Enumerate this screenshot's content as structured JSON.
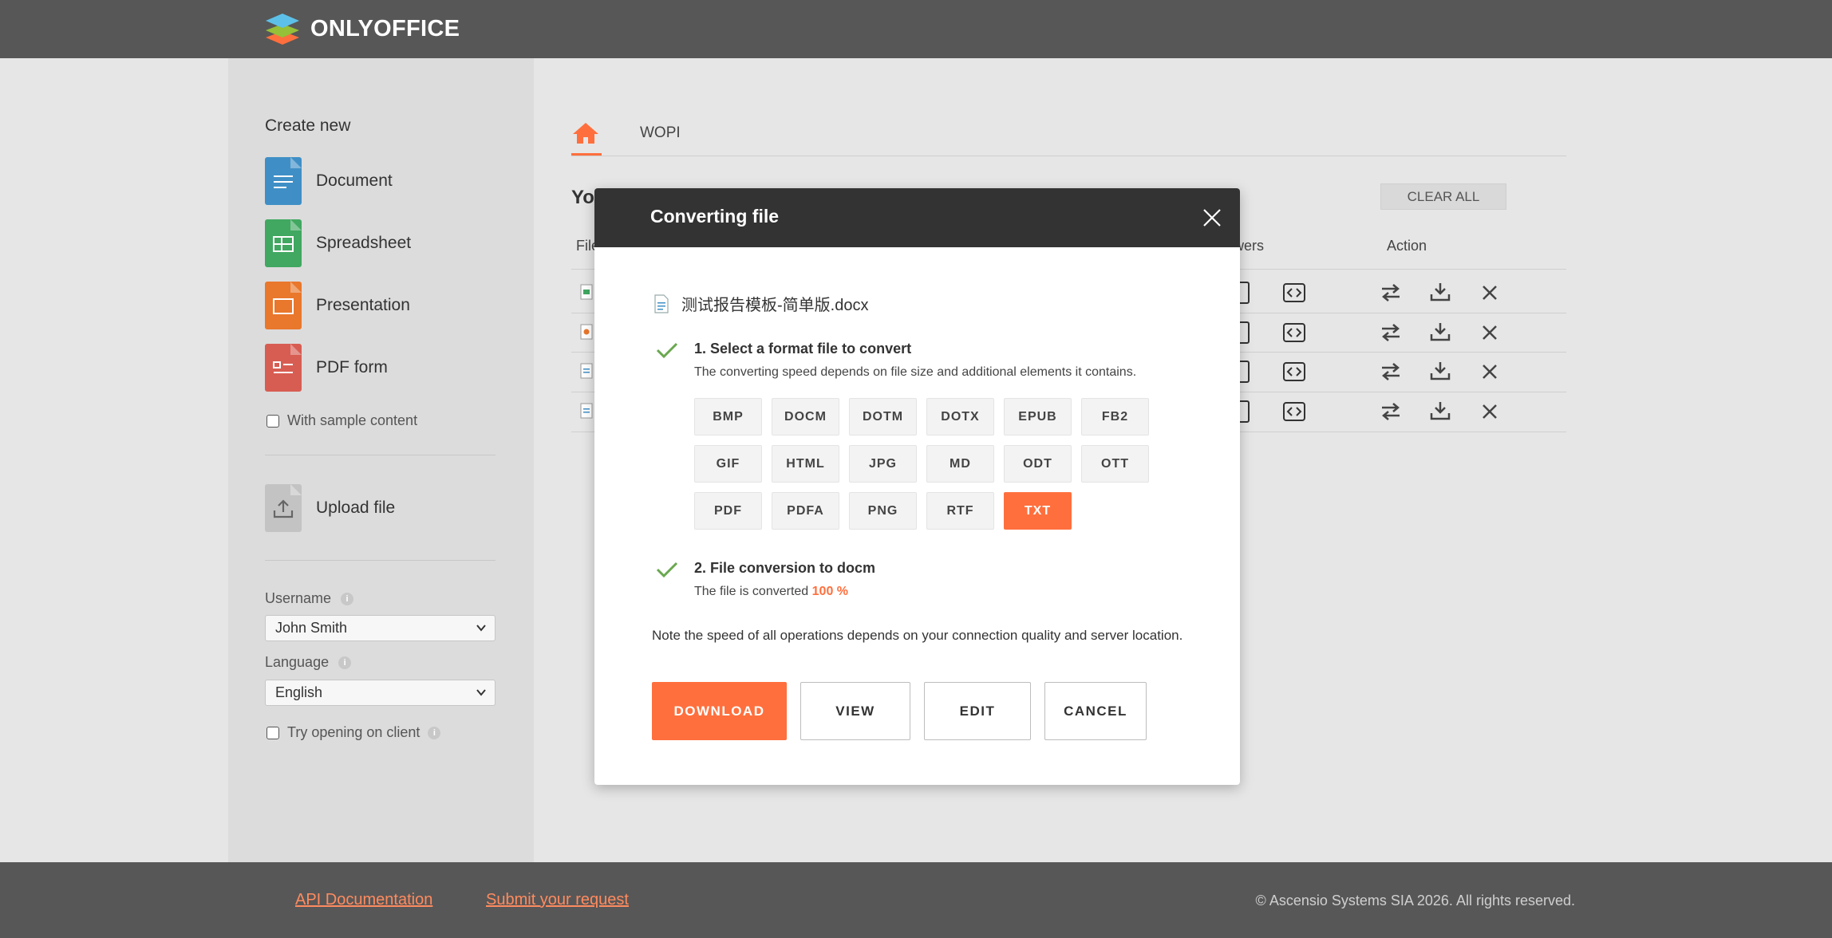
{
  "header": {
    "brand": "ONLYOFFICE"
  },
  "sidebar": {
    "create_title": "Create new",
    "create_items": [
      {
        "label": "Document",
        "color": "#3f8fc6",
        "icon": "document-icon"
      },
      {
        "label": "Spreadsheet",
        "color": "#40a860",
        "icon": "spreadsheet-icon"
      },
      {
        "label": "Presentation",
        "color": "#e9772c",
        "icon": "presentation-icon"
      },
      {
        "label": "PDF form",
        "color": "#d75d52",
        "icon": "pdf-form-icon"
      }
    ],
    "sample_label": "With sample content",
    "upload_label": "Upload file",
    "username_label": "Username",
    "username_value": "John Smith",
    "language_label": "Language",
    "language_value": "English",
    "try_client_label": "Try opening on client"
  },
  "main": {
    "tab_wopi": "WOPI",
    "your_files": "Yo",
    "clear_all": "CLEAR ALL",
    "col_file": "File",
    "col_viewers": "wers",
    "col_action": "Action"
  },
  "modal": {
    "title": "Converting file",
    "file_name": "测试报告模板-简单版.docx",
    "step1_title": "1. Select a format file to convert",
    "step1_sub": "The converting speed depends on file size and additional elements it contains.",
    "formats": [
      "BMP",
      "DOCM",
      "DOTM",
      "DOTX",
      "EPUB",
      "FB2",
      "GIF",
      "HTML",
      "JPG",
      "MD",
      "ODT",
      "OTT",
      "PDF",
      "PDFA",
      "PNG",
      "RTF",
      "TXT"
    ],
    "active_format": "TXT",
    "step2_title": "2. File conversion to docm",
    "step2_sub_prefix": "The file is converted",
    "step2_pct": "100 %",
    "note": "Note the speed of all operations depends on your connection quality and server location.",
    "buttons": {
      "download": "DOWNLOAD",
      "view": "VIEW",
      "edit": "EDIT",
      "cancel": "CANCEL"
    }
  },
  "footer": {
    "api_docs": "API Documentation",
    "submit": "Submit your request",
    "copyright": "© Ascensio Systems SIA 2026. All rights reserved."
  },
  "colors": {
    "accent": "#ff6f3d",
    "header": "#575757",
    "modal_head": "#333333",
    "check": "#6aa84f"
  }
}
